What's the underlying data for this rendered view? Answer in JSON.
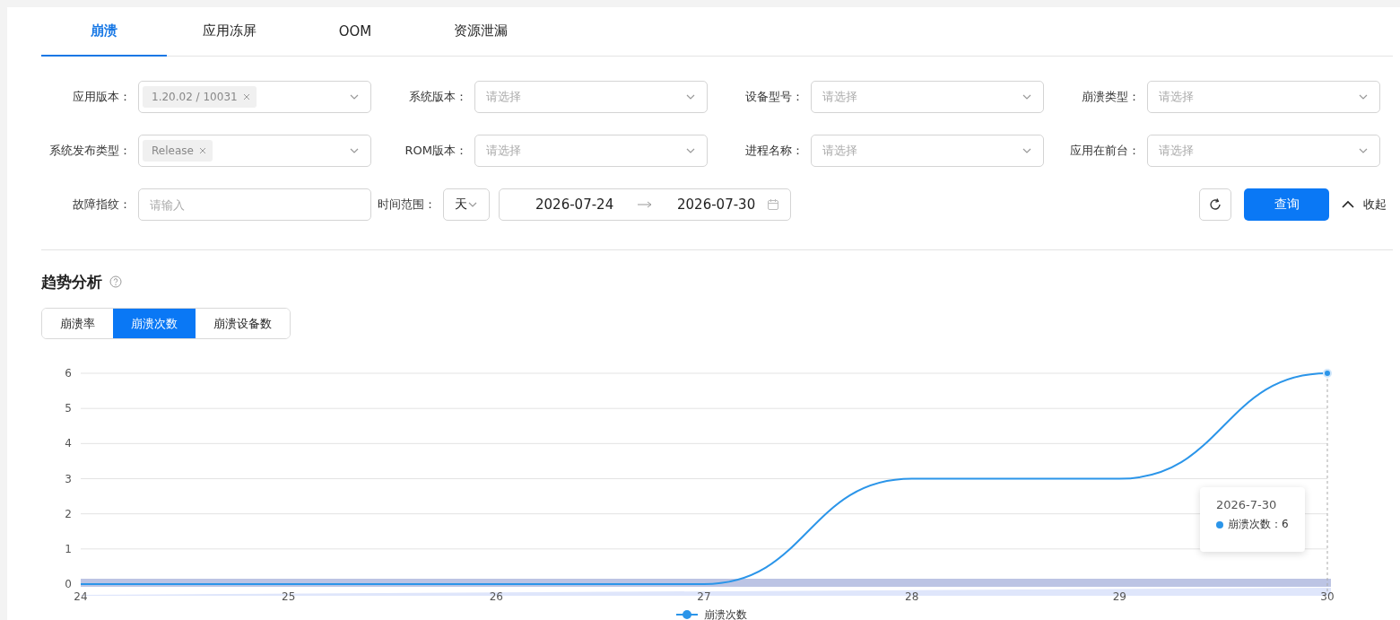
{
  "tabs": [
    {
      "label": "崩溃",
      "selected": true
    },
    {
      "label": "应用冻屏",
      "selected": false
    },
    {
      "label": "OOM",
      "selected": false
    },
    {
      "label": "资源泄漏",
      "selected": false
    }
  ],
  "filters": [
    {
      "label": "应用版本：",
      "kind": "select",
      "tags": [
        "1.20.02 / 10031"
      ]
    },
    {
      "label": "系统版本：",
      "kind": "select",
      "placeholder": "请选择"
    },
    {
      "label": "设备型号：",
      "kind": "select",
      "placeholder": "请选择"
    },
    {
      "label": "崩溃类型：",
      "kind": "select",
      "placeholder": "请选择"
    },
    {
      "label": "系统发布类型：",
      "kind": "select",
      "tags": [
        "Release"
      ]
    },
    {
      "label": "ROM版本：",
      "kind": "select",
      "placeholder": "请选择"
    },
    {
      "label": "进程名称：",
      "kind": "select",
      "placeholder": "请选择"
    },
    {
      "label": "应用在前台：",
      "kind": "select",
      "placeholder": "请选择"
    },
    {
      "label": "故障指纹：",
      "kind": "input",
      "placeholder": "请输入"
    },
    {
      "label": "时间范围：",
      "kind": "range",
      "unit": "天",
      "start": "2026-07-24",
      "end": "2026-07-30"
    }
  ],
  "actions": {
    "query": "查询",
    "collapse": "收起"
  },
  "section": {
    "title": "趋势分析"
  },
  "metrics": [
    {
      "label": "崩溃率",
      "selected": false
    },
    {
      "label": "崩溃次数",
      "selected": true
    },
    {
      "label": "崩溃设备数",
      "selected": false
    }
  ],
  "chart_data": {
    "type": "line",
    "categories": [
      "24",
      "25",
      "26",
      "27",
      "28",
      "29",
      "30"
    ],
    "series": [
      {
        "name": "崩溃次数",
        "color": "#2b95e9",
        "values": [
          0,
          0,
          0,
          0,
          3,
          3,
          6
        ]
      }
    ],
    "ylim": [
      0,
      6
    ],
    "yticks": [
      0,
      1,
      2,
      3,
      4,
      5,
      6
    ],
    "grid": true
  },
  "tooltip": {
    "title": "2026-7-30",
    "label": "崩溃次数：",
    "value": "6"
  }
}
